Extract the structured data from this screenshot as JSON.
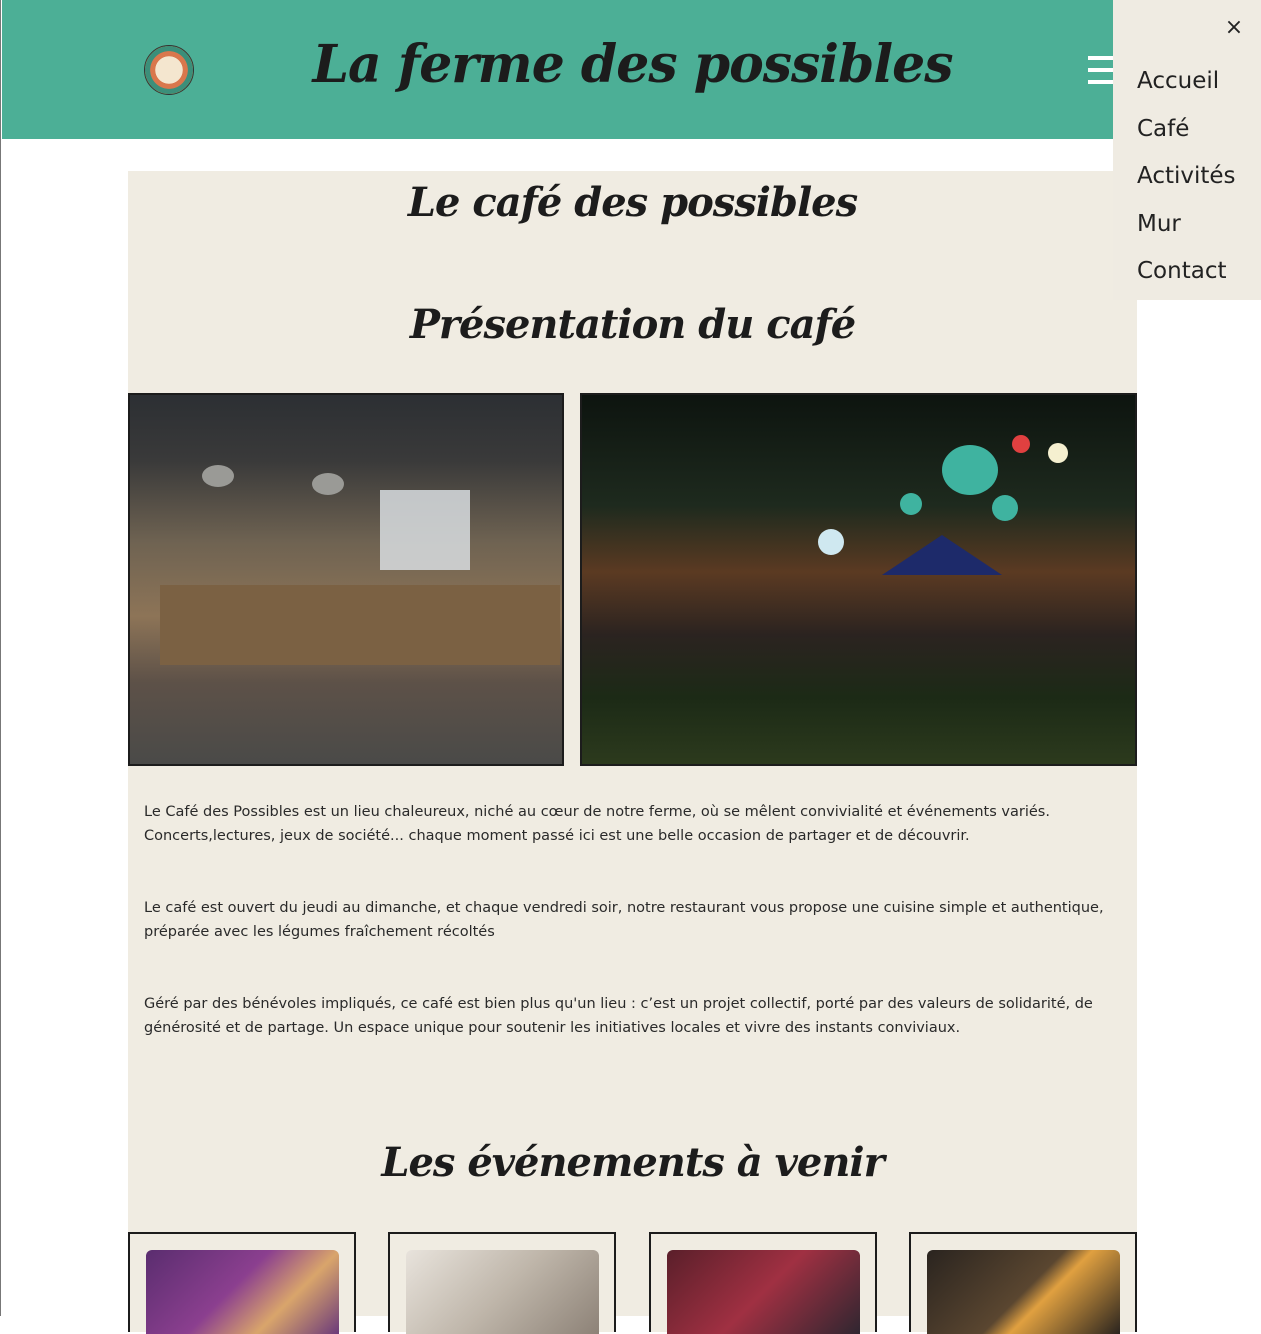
{
  "header": {
    "title": "La ferme des possibles",
    "logo_icon": "farm-logo-icon",
    "menu_icon": "hamburger-icon",
    "background_color": "#4caf96"
  },
  "nav_menu": {
    "close_icon": "close-icon",
    "close_glyph": "×",
    "items": [
      {
        "label": "Accueil"
      },
      {
        "label": "Café"
      },
      {
        "label": "Activités"
      },
      {
        "label": "Mur"
      },
      {
        "label": "Contact"
      }
    ]
  },
  "page": {
    "title": "Le café des possibles",
    "presentation_title": "Présentation du café",
    "paragraphs": [
      "Le Café des Possibles est un lieu chaleureux, niché au cœur de notre ferme, où se mêlent convivialité et événements variés. Concerts,lectures, jeux de société... chaque moment passé ici est une belle occasion de partager et de découvrir.",
      "Le café est ouvert du jeudi au dimanche, et chaque vendredi soir, notre restaurant vous propose une cuisine simple et authentique, préparée avec les légumes fraîchement récoltés",
      "Géré par des bénévoles impliqués, ce café est bien plus qu'un lieu : c’est un projet collectif, porté par des valeurs de solidarité, de générosité et de partage. Un espace unique pour soutenir les initiatives locales et vivre des instants conviviaux."
    ],
    "events_title": "Les événements à venir",
    "content_background": "#f0ece2"
  }
}
